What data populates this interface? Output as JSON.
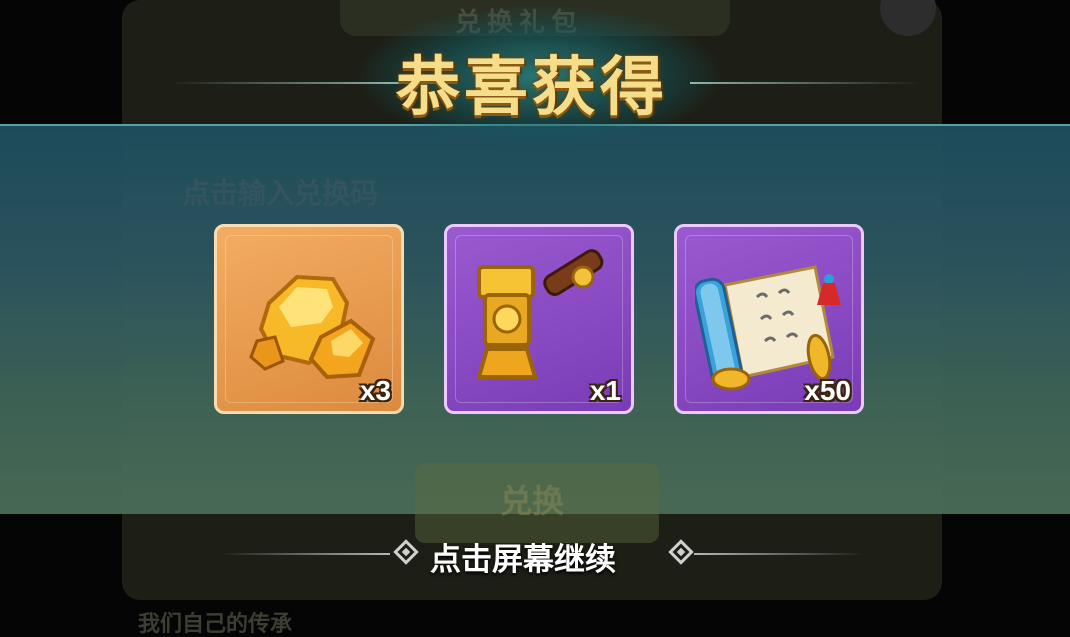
{
  "background": {
    "header_text": "兑换礼包",
    "input_hint": "点击输入兑换码",
    "button_label": "兑换",
    "sub_text": "我们自己的传承"
  },
  "title": "恭喜获得",
  "rewards": [
    {
      "icon": "gold-ore-icon",
      "count": "x3",
      "rarity": "orange"
    },
    {
      "icon": "golden-hammer-icon",
      "count": "x1",
      "rarity": "purple"
    },
    {
      "icon": "scroll-icon",
      "count": "x50",
      "rarity": "purple"
    }
  ],
  "continue_prompt": "点击屏幕继续",
  "colors": {
    "title_gold": "#f5dd8a",
    "overlay_top": "#1f4e5d",
    "overlay_bottom": "#4a6c57",
    "orange_card": "#e89a4c",
    "purple_card": "#8a4cc4"
  }
}
